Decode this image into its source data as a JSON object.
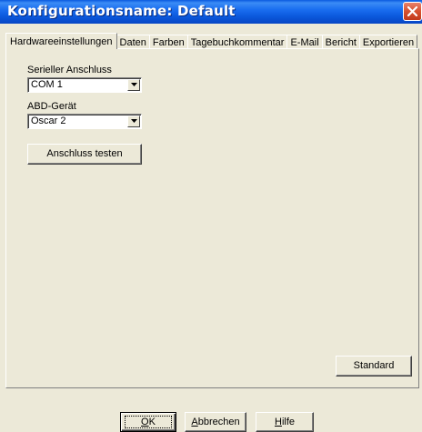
{
  "window": {
    "title": "Konfigurationsname: Default"
  },
  "tabs": [
    {
      "label": "Hardwareeinstellungen",
      "active": true
    },
    {
      "label": "Daten",
      "active": false
    },
    {
      "label": "Farben",
      "active": false
    },
    {
      "label": "Tagebuchkommentar",
      "active": false
    },
    {
      "label": "E-Mail",
      "active": false
    },
    {
      "label": "Bericht",
      "active": false
    },
    {
      "label": "Exportieren",
      "active": false
    }
  ],
  "hardware": {
    "serial_label": "Serieller Anschluss",
    "serial_value": "COM 1",
    "device_label": "ABD-Gerät",
    "device_value": "Oscar 2",
    "test_button": "Anschluss testen",
    "standard_button": "Standard"
  },
  "footer": {
    "ok_accel": "O",
    "ok_rest": "K",
    "cancel_accel": "A",
    "cancel_rest": "bbrechen",
    "help_accel": "H",
    "help_rest": "ilfe"
  },
  "colors": {
    "titlebar": "#0a58dc",
    "close_button": "#d6512f",
    "dialog_face": "#ece9d8"
  }
}
